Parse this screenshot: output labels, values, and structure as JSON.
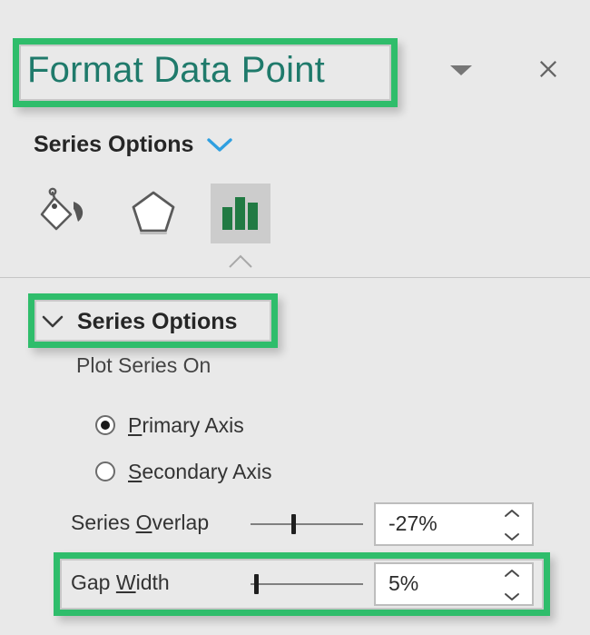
{
  "pane": {
    "title": "Format Data Point",
    "dropdown_icon": "triangle-down-icon",
    "close_icon": "close-icon",
    "title_color": "#1f7a6b",
    "background_color": "#e9e9e9"
  },
  "highlight": {
    "color": "#2fbd6b",
    "targets": [
      "pane-title",
      "series-options-section",
      "gap-width-row"
    ]
  },
  "options_picker": {
    "label": "Series Options",
    "chevron_icon": "chevron-down-icon",
    "chevron_color": "#2f9fe0"
  },
  "tabs": [
    {
      "name": "fill-and-line",
      "icon": "paint-bucket-icon",
      "selected": false
    },
    {
      "name": "effects",
      "icon": "pentagon-icon",
      "selected": false
    },
    {
      "name": "series-options",
      "icon": "bar-chart-icon",
      "selected": true
    }
  ],
  "section": {
    "label": "Series Options",
    "chevron_icon": "chevron-down-icon",
    "expanded": true
  },
  "plot_series_on": {
    "label": "Plot Series On",
    "options": [
      {
        "label": "Primary Axis",
        "accel": "P",
        "selected": true
      },
      {
        "label": "Secondary Axis",
        "accel": "S",
        "selected": false
      }
    ]
  },
  "sliders": [
    {
      "label": "Series Overlap",
      "accel": "O",
      "value": "-27%",
      "thumb_percent": 38,
      "up_icon": "chevron-up-icon",
      "down_icon": "chevron-down-icon"
    },
    {
      "label": "Gap Width",
      "accel": "W",
      "value": "5%",
      "thumb_percent": 3,
      "up_icon": "chevron-up-icon",
      "down_icon": "chevron-down-icon"
    }
  ]
}
